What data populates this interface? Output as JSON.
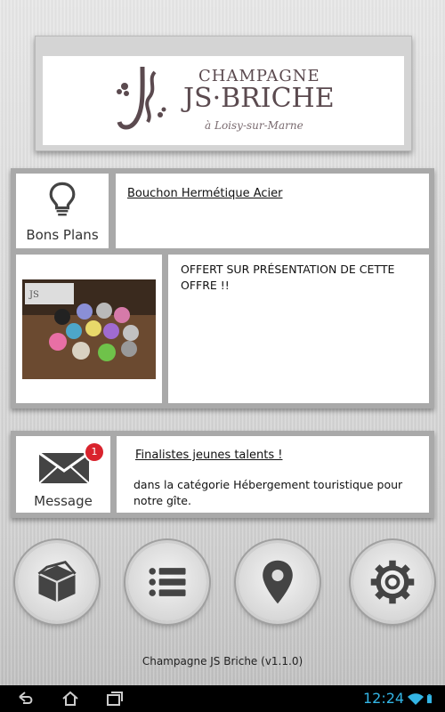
{
  "brand": {
    "line1": "CHAMPAGNE",
    "line2": "JS·BRICHE",
    "line3": "à Loisy-sur-Marne"
  },
  "bons_plans": {
    "label": "Bons Plans",
    "title": "Bouchon Hermétique Acier",
    "description": "OFFERT SUR PRÉSENTATION DE CETTE OFFRE !!"
  },
  "message": {
    "label": "Message",
    "badge": "1",
    "title": "Finalistes jeunes talents !",
    "body": "dans la catégorie Hébergement touristique pour notre gîte."
  },
  "footer": {
    "version": "Champagne JS Briche (v1.1.0)"
  },
  "buttons": [
    {
      "icon": "box-icon"
    },
    {
      "icon": "list-icon"
    },
    {
      "icon": "location-pin-icon"
    },
    {
      "icon": "gear-icon"
    }
  ],
  "status_bar": {
    "time": "12:24"
  },
  "colors": {
    "brand": "#5b4a4f",
    "icon_dark": "#444444",
    "clock": "#33b5e5",
    "badge": "#d9232d"
  }
}
